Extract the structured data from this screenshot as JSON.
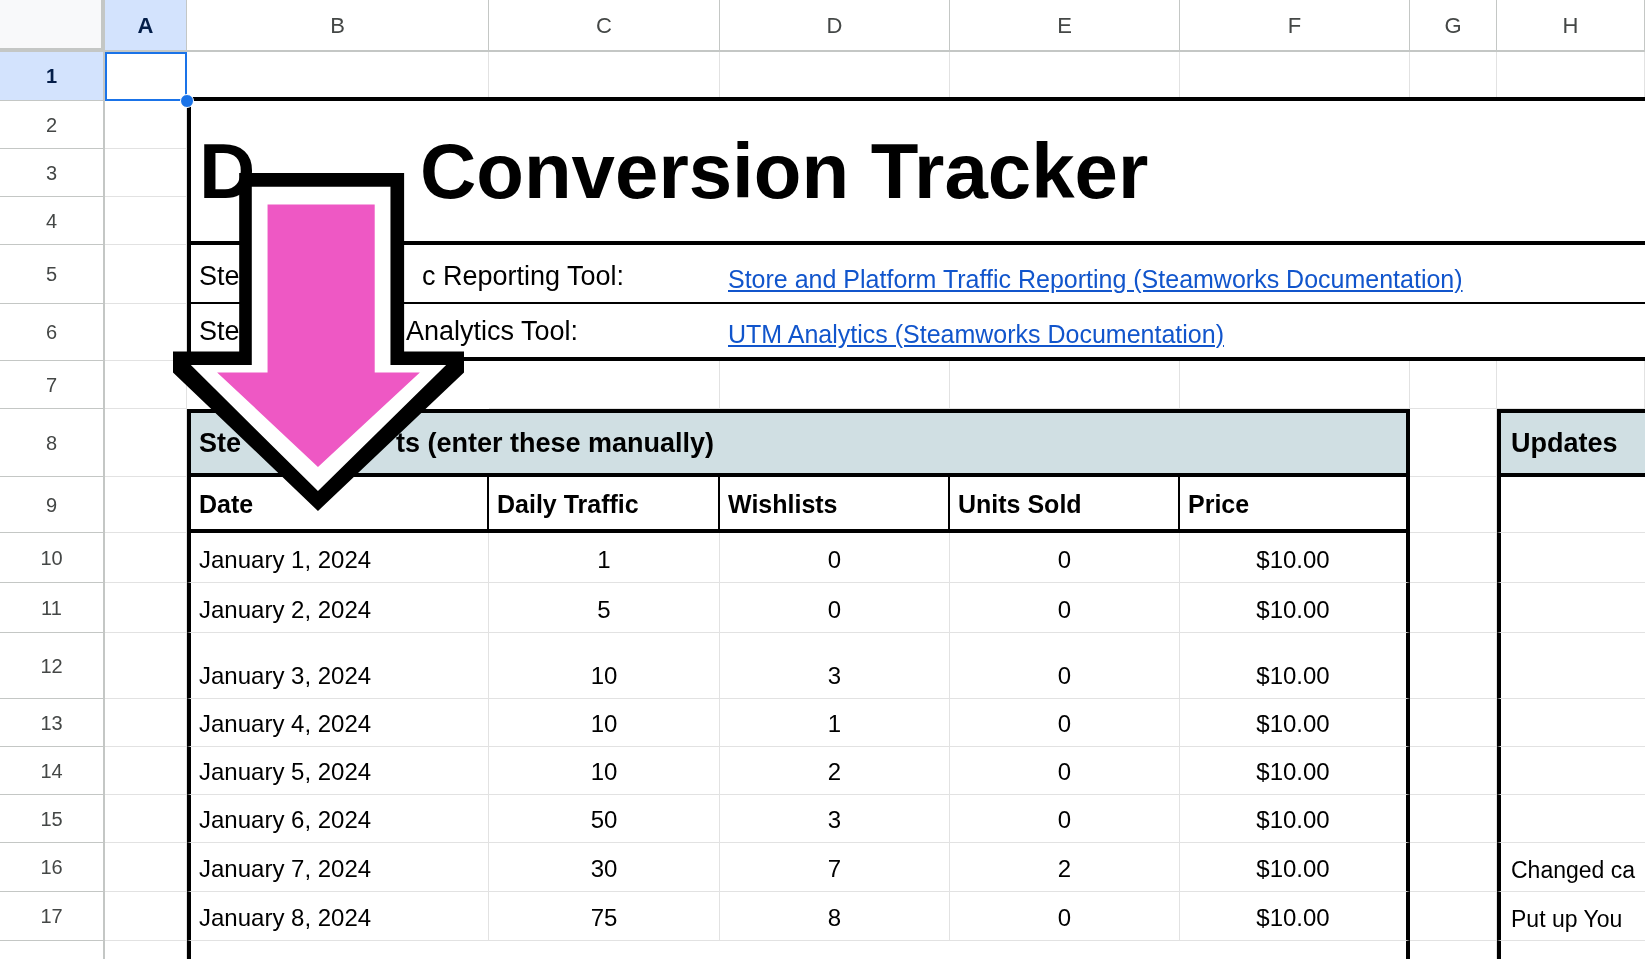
{
  "columns": [
    {
      "label": "A",
      "selected": true
    },
    {
      "label": "B",
      "selected": false
    },
    {
      "label": "C",
      "selected": false
    },
    {
      "label": "D",
      "selected": false
    },
    {
      "label": "E",
      "selected": false
    },
    {
      "label": "F",
      "selected": false
    },
    {
      "label": "G",
      "selected": false
    },
    {
      "label": "H",
      "selected": false
    }
  ],
  "rows": [
    {
      "label": "1",
      "selected": true
    },
    {
      "label": "2",
      "selected": false
    },
    {
      "label": "3",
      "selected": false
    },
    {
      "label": "4",
      "selected": false
    },
    {
      "label": "5",
      "selected": false
    },
    {
      "label": "6",
      "selected": false
    },
    {
      "label": "7",
      "selected": false
    },
    {
      "label": "8",
      "selected": false
    },
    {
      "label": "9",
      "selected": false
    },
    {
      "label": "10",
      "selected": false
    },
    {
      "label": "11",
      "selected": false
    },
    {
      "label": "12",
      "selected": false
    },
    {
      "label": "13",
      "selected": false
    },
    {
      "label": "14",
      "selected": false
    },
    {
      "label": "15",
      "selected": false
    },
    {
      "label": "16",
      "selected": false
    },
    {
      "label": "17",
      "selected": false
    }
  ],
  "title_parts": [
    "D",
    "Conversion Tracker"
  ],
  "links": [
    {
      "label_parts": [
        "Ste",
        "c Reporting Tool:"
      ],
      "link": "Store and Platform Traffic Reporting (Steamworks Documentation)"
    },
    {
      "label_parts": [
        "Ste",
        "Analytics Tool:"
      ],
      "link": "UTM Analytics (Steamworks Documentation)"
    }
  ],
  "table": {
    "title_parts": [
      "Ste",
      "ts (enter these manually)"
    ],
    "columns": [
      "Date",
      "Daily Traffic",
      "Wishlists",
      "Units Sold",
      "Price"
    ],
    "rows": [
      [
        "January 1, 2024",
        "1",
        "0",
        "0",
        "$10.00"
      ],
      [
        "January 2, 2024",
        "5",
        "0",
        "0",
        "$10.00"
      ],
      [
        "January 3, 2024",
        "10",
        "3",
        "0",
        "$10.00"
      ],
      [
        "January 4, 2024",
        "10",
        "1",
        "0",
        "$10.00"
      ],
      [
        "January 5, 2024",
        "10",
        "2",
        "0",
        "$10.00"
      ],
      [
        "January 6, 2024",
        "50",
        "3",
        "0",
        "$10.00"
      ],
      [
        "January 7, 2024",
        "30",
        "7",
        "2",
        "$10.00"
      ],
      [
        "January 8, 2024",
        "75",
        "8",
        "0",
        "$10.00"
      ]
    ]
  },
  "updates": {
    "title": "Updates",
    "notes": [
      "Changed ca",
      "Put up You"
    ]
  }
}
